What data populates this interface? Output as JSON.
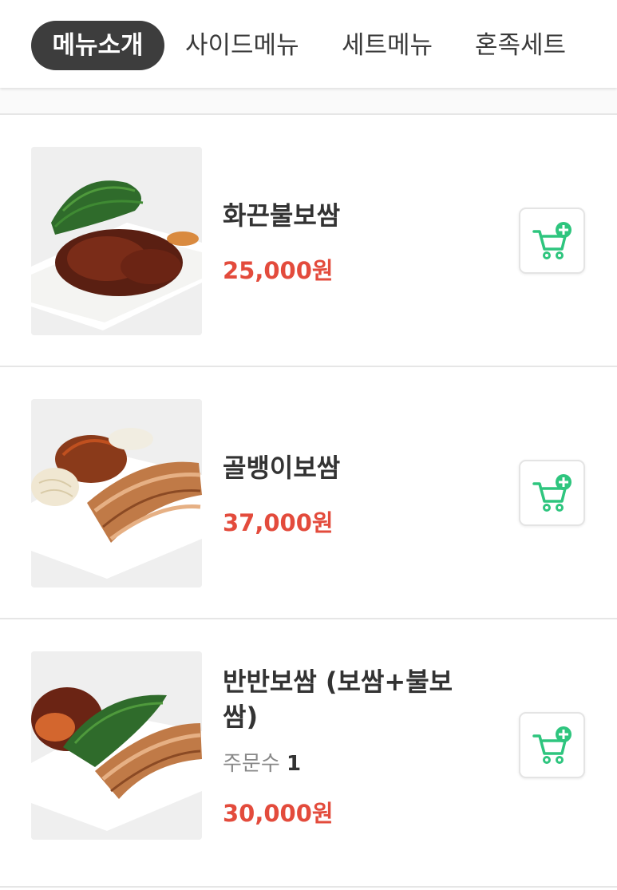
{
  "tabs": [
    {
      "label": "메뉴소개",
      "active": true
    },
    {
      "label": "사이드메뉴",
      "active": false
    },
    {
      "label": "세트메뉴",
      "active": false
    },
    {
      "label": "혼족세트",
      "active": false
    }
  ],
  "menu_items": [
    {
      "name": "화끈불보쌈",
      "price": "25,000원",
      "orders_label": "",
      "orders_count": ""
    },
    {
      "name": "골뱅이보쌈",
      "price": "37,000원",
      "orders_label": "",
      "orders_count": ""
    },
    {
      "name": "반반보쌈 (보쌈+불보쌈)",
      "price": "30,000원",
      "orders_label": "주문수",
      "orders_count": "1"
    }
  ],
  "colors": {
    "accent_price": "#e34b3c",
    "cart_icon": "#2ec57e",
    "active_tab_bg": "#3d3d3d"
  },
  "icons": {
    "cart": "cart-add-icon"
  }
}
